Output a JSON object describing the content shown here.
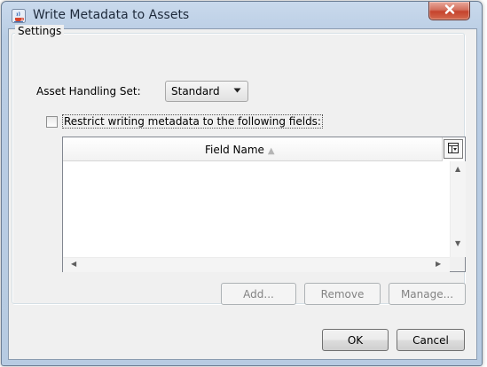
{
  "window": {
    "title": "Write Metadata to Assets",
    "icon": "java-cup-icon",
    "close_glyph": "✕"
  },
  "settings": {
    "group_label": "Settings",
    "asset_handling_label": "Asset Handling Set:",
    "asset_handling_value": "Standard",
    "restrict_checked": false,
    "restrict_label": "Restrict writing metadata to the following fields:"
  },
  "table": {
    "columns": [
      "Field Name"
    ],
    "sort": "ascending",
    "rows": []
  },
  "buttons": {
    "add": "Add...",
    "remove": "Remove",
    "manage": "Manage...",
    "ok": "OK",
    "cancel": "Cancel"
  }
}
